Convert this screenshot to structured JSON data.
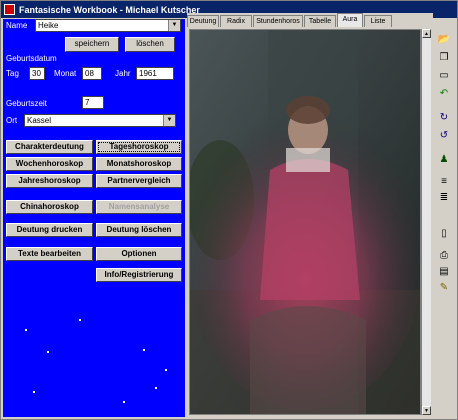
{
  "window": {
    "title": "Fantasische Workbook - Michael Kutscher"
  },
  "form": {
    "name_label": "Name",
    "name_value": "Heike",
    "save_label": "speichern",
    "delete_label": "löschen",
    "birthdate_label": "Geburtsdatum",
    "day_label": "Tag",
    "day_value": "30",
    "month_label": "Monat",
    "month_value": "08",
    "year_label": "Jahr",
    "year_value": "1961",
    "birthtime_label": "Geburtszeit",
    "birthtime_value": "7",
    "place_label": "Ort",
    "place_value": "Kassel"
  },
  "buttons": {
    "charakterdeutung": "Charakterdeutung",
    "tageshoroskop": "Tageshoroskop",
    "wochenhoroskop": "Wochenhoroskop",
    "monatshoroskop": "Monatshoroskop",
    "jahreshoroskop": "Jahreshoroskop",
    "partnervergleich": "Partnervergleich",
    "chinahoroskop": "Chinahoroskop",
    "namensanalyse": "Namensanalyse",
    "deutung_drucken": "Deutung drucken",
    "deutung_loeschen": "Deutung löschen",
    "texte_bearbeiten": "Texte bearbeiten",
    "optionen": "Optionen",
    "info": "Info/Registrierung"
  },
  "tabs": [
    "Deutung",
    "Radix",
    "Stundenhoros",
    "Tabelle",
    "Aura",
    "Liste"
  ],
  "active_tab": "Aura",
  "colors": {
    "title_bar": "#0a246a",
    "left_panel": "#0000ff",
    "window_face": "#d4d0c8"
  },
  "toolbar": [
    {
      "name": "open-icon",
      "glyph": "📂"
    },
    {
      "name": "copy-icon",
      "glyph": "❐"
    },
    {
      "name": "print-preview-icon",
      "glyph": "▭"
    },
    {
      "name": "undo-icon",
      "glyph": "↶"
    },
    {
      "name": "refresh-icon",
      "glyph": "↻"
    },
    {
      "name": "reload-icon",
      "glyph": "↺"
    },
    {
      "name": "person-icon",
      "glyph": "♟"
    },
    {
      "name": "align-top-icon",
      "glyph": "≡"
    },
    {
      "name": "align-bottom-icon",
      "glyph": "≣"
    },
    {
      "name": "columns-icon",
      "glyph": "▯"
    },
    {
      "name": "printer-icon",
      "glyph": "⎙"
    },
    {
      "name": "document-icon",
      "glyph": "▤"
    },
    {
      "name": "paint-icon",
      "glyph": "✎"
    }
  ]
}
